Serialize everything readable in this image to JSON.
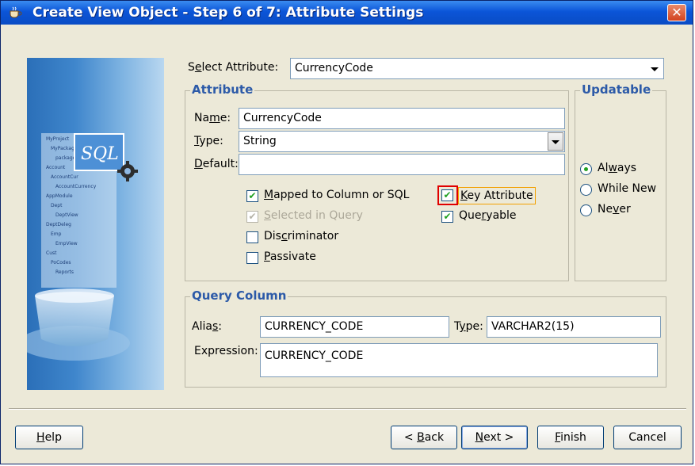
{
  "window": {
    "title": "Create View Object - Step 6 of 7: Attribute Settings",
    "close_glyph": "✕"
  },
  "select_attribute": {
    "label_pre": "S",
    "label_ul": "e",
    "label_post": "lect Attribute:",
    "value": "CurrencyCode"
  },
  "attribute_group": {
    "title": "Attribute",
    "name": {
      "label_pre": "Na",
      "label_ul": "m",
      "label_post": "e:",
      "value": "CurrencyCode"
    },
    "type": {
      "label_pre": "",
      "label_ul": "T",
      "label_post": "ype:",
      "value": "String"
    },
    "default": {
      "label_pre": "",
      "label_ul": "D",
      "label_post": "efault:",
      "value": ""
    },
    "checkboxes": {
      "mapped": {
        "pre": "",
        "ul": "M",
        "post": "apped to Column or SQL",
        "checked": true,
        "enabled": true
      },
      "selected_in_query": {
        "pre": "",
        "ul": "S",
        "post": "elected in Query",
        "checked": true,
        "enabled": false
      },
      "discriminator": {
        "pre": "Dis",
        "ul": "c",
        "post": "riminator",
        "checked": false,
        "enabled": true
      },
      "passivate": {
        "pre": "",
        "ul": "P",
        "post": "assivate",
        "checked": false,
        "enabled": true
      },
      "key_attribute": {
        "pre": "",
        "ul": "K",
        "post": "ey Attribute",
        "checked": true,
        "enabled": true
      },
      "queryable": {
        "pre": "Que",
        "ul": "r",
        "post": "yable",
        "checked": true,
        "enabled": true
      }
    }
  },
  "updatable_group": {
    "title": "Updatable",
    "options": [
      {
        "pre": "Al",
        "ul": "w",
        "post": "ays",
        "selected": true
      },
      {
        "pre": "While New",
        "ul": "",
        "post": "",
        "selected": false
      },
      {
        "pre": "Ne",
        "ul": "v",
        "post": "er",
        "selected": false
      }
    ]
  },
  "query_column_group": {
    "title": "Query Column",
    "alias": {
      "label_pre": "Alia",
      "label_ul": "s",
      "label_post": ":",
      "value": "CURRENCY_CODE"
    },
    "type": {
      "label_pre": "T",
      "label_ul": "y",
      "label_post": "pe:",
      "value": "VARCHAR2(15)"
    },
    "expression": {
      "label": "Expression:",
      "value": "CURRENCY_CODE"
    }
  },
  "buttons": {
    "help": {
      "pre": "",
      "ul": "H",
      "post": "elp"
    },
    "back": {
      "pre": "< ",
      "ul": "B",
      "post": "ack"
    },
    "next": {
      "pre": "",
      "ul": "N",
      "post": "ext >"
    },
    "finish": {
      "pre": "",
      "ul": "F",
      "post": "inish"
    },
    "cancel": {
      "pre": "Cancel",
      "ul": "",
      "post": ""
    }
  },
  "side_image": {
    "sql_text": "SQL",
    "tree_items": [
      "MyProject",
      "MyPackage",
      "package",
      "Account",
      "AccountCur",
      "AccountCurrency",
      "AppModule",
      "Dept",
      "DeptView",
      "DeptDeleg",
      "Emp",
      "EmpView",
      "Cust",
      "PoCodes",
      "Reports"
    ]
  },
  "icons": {
    "title": "coffee-cup-icon",
    "close": "close-icon",
    "dropdown": "chevron-down-icon",
    "check": "checkmark-icon",
    "gear": "gear-icon"
  },
  "colors": {
    "titlebar": "#0b55d8",
    "group_title": "#2c5aa8",
    "check": "#21a121",
    "highlight": "#e00000",
    "key_focus": "#f2a000"
  }
}
